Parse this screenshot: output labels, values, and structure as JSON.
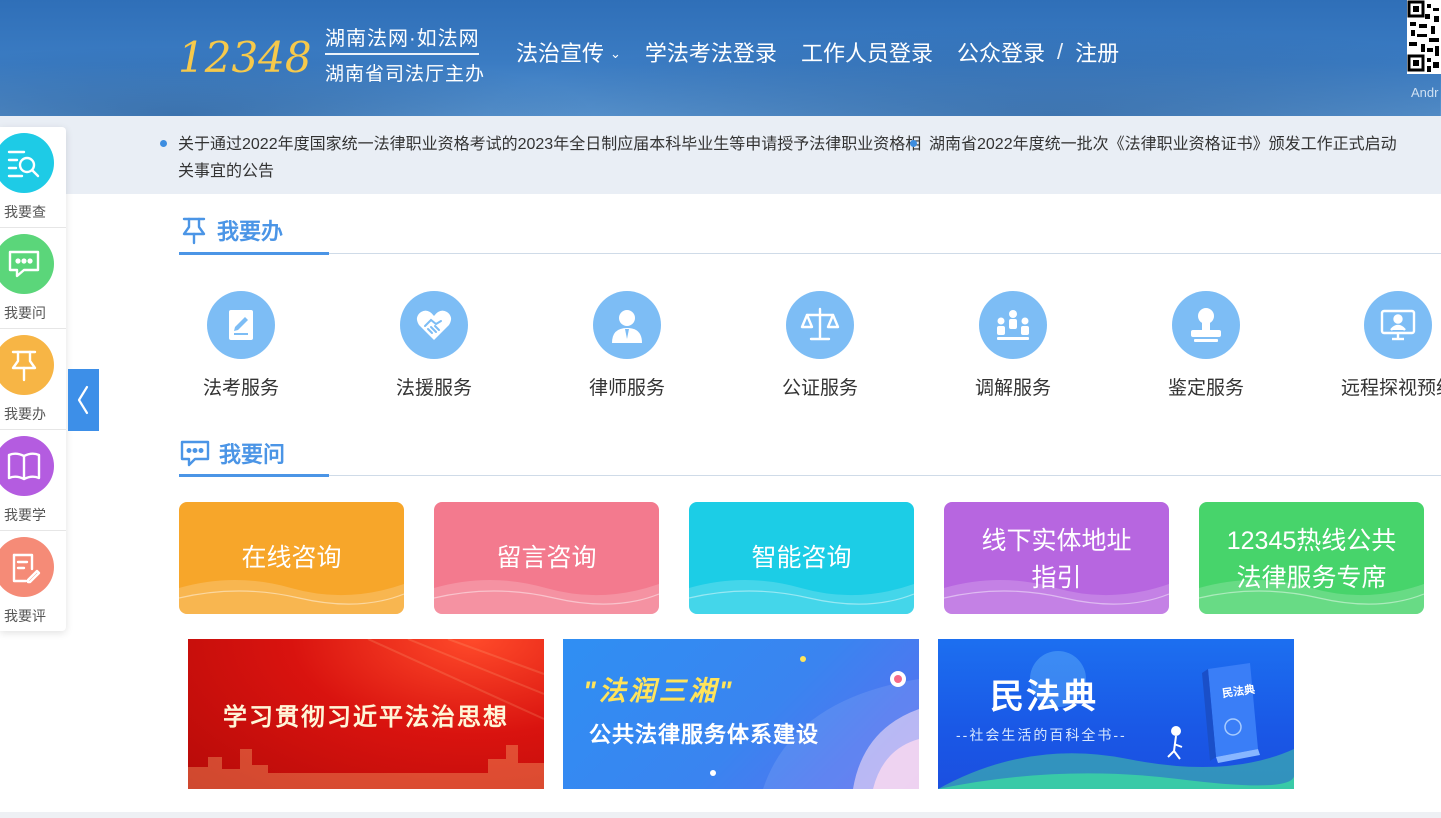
{
  "header": {
    "logo_digits": "12348",
    "site_name": "湖南法网·如法网",
    "sponsor": "湖南省司法厅主办",
    "nav": [
      {
        "label": "法治宣传",
        "has_dropdown": true
      },
      {
        "label": "学法考法登录"
      },
      {
        "label": "工作人员登录"
      },
      {
        "label": "公众登录"
      }
    ],
    "nav_separator": "/",
    "nav_register": "注册",
    "qr_label": "Andr"
  },
  "notices": [
    "关于通过2022年度国家统一法律职业资格考试的2023年全日制应届本科毕业生等申请授予法律职业资格相关事宜的公告",
    "湖南省2022年度统一批次《法律职业资格证书》颁发工作正式启动"
  ],
  "sidebar": {
    "items": [
      {
        "label": "我要查",
        "icon": "search-list-icon",
        "color": "#1ecbe6"
      },
      {
        "label": "我要问",
        "icon": "chat-icon",
        "color": "#5bd67a"
      },
      {
        "label": "我要办",
        "icon": "pin-icon",
        "color": "#f7b545"
      },
      {
        "label": "我要学",
        "icon": "book-icon",
        "color": "#b45ce0"
      },
      {
        "label": "我要评",
        "icon": "clipboard-edit-icon",
        "color": "#f58b77"
      }
    ]
  },
  "section_do": {
    "title": "我要办",
    "icon": "pin-icon"
  },
  "services": [
    {
      "label": "法考服务",
      "icon": "exam-doc-icon"
    },
    {
      "label": "法援服务",
      "icon": "handshake-heart-icon"
    },
    {
      "label": "律师服务",
      "icon": "lawyer-icon"
    },
    {
      "label": "公证服务",
      "icon": "scales-icon"
    },
    {
      "label": "调解服务",
      "icon": "mediation-icon"
    },
    {
      "label": "鉴定服务",
      "icon": "stamp-icon"
    },
    {
      "label": "远程探视预约",
      "icon": "video-monitor-icon"
    }
  ],
  "section_ask": {
    "title": "我要问",
    "icon": "chat-icon"
  },
  "ask_cards": [
    {
      "lines": [
        "在线咨询"
      ],
      "color": "#f7a62a"
    },
    {
      "lines": [
        "留言咨询"
      ],
      "color": "#f37a8e"
    },
    {
      "lines": [
        "智能咨询"
      ],
      "color": "#1ccde6"
    },
    {
      "lines": [
        "线下实体地址",
        "指引"
      ],
      "color": "#b766e0"
    },
    {
      "lines": [
        "12345热线公共",
        "法律服务专席"
      ],
      "color": "#47d46b"
    }
  ],
  "banners": [
    {
      "text": "学习贯彻习近平法治思想"
    },
    {
      "title": "\"法润三湘\"",
      "subtitle": "公共法律服务体系建设"
    },
    {
      "title": "民法典",
      "subtitle": "--社会生活的百科全书--",
      "book_label": "民法典"
    }
  ]
}
